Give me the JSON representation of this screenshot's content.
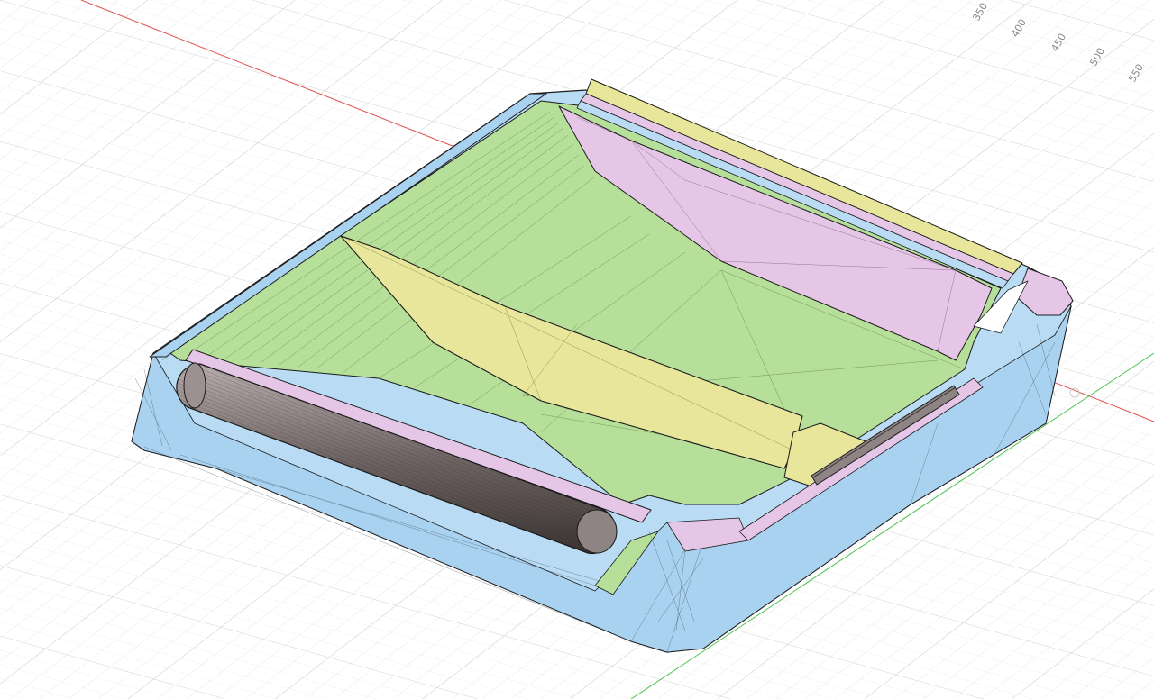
{
  "viewport": {
    "background": "#ffffff",
    "grid_minor_color": "#e6e6e6",
    "grid_major_color": "#cfcfcf",
    "axis_x_color": "#e05050",
    "axis_y_color": "#4cc24c"
  },
  "ruler": {
    "labels": [
      "350",
      "400",
      "450",
      "500",
      "550"
    ]
  },
  "model": {
    "shell_color": "#b9dcf4",
    "floor_color": "#b6e09a",
    "divider_color": "#e7e69a",
    "wall_color": "#e6c6e6",
    "rod_color": "#8e8484",
    "edge_color": "#1a1a1a"
  }
}
